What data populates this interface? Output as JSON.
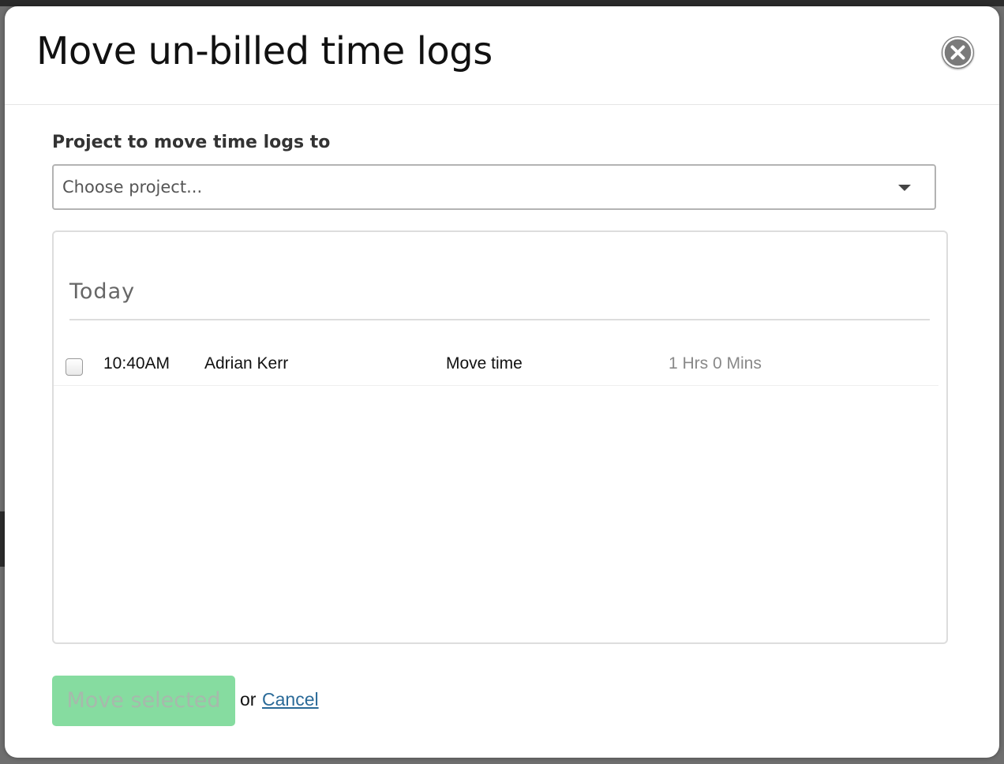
{
  "dialog": {
    "title": "Move un-billed time logs",
    "close_icon": "close-circle-icon"
  },
  "form": {
    "project_label": "Project to move time logs to",
    "project_select": {
      "placeholder": "Choose project...",
      "selected_value": "",
      "caret_icon": "chevron-down-icon"
    }
  },
  "logs": {
    "groups": [
      {
        "heading": "Today",
        "rows": [
          {
            "checked": false,
            "time": "10:40AM",
            "user": "Adrian Kerr",
            "description": "Move time",
            "duration": "1 Hrs 0 Mins"
          }
        ]
      }
    ]
  },
  "footer": {
    "move_selected_label": "Move selected",
    "move_selected_disabled": true,
    "or_text": "or",
    "cancel_label": "Cancel"
  },
  "colors": {
    "move_button_bg": "#86dca0",
    "cancel_link": "#2a6a98",
    "close_button_bg": "#7a7a7a"
  }
}
